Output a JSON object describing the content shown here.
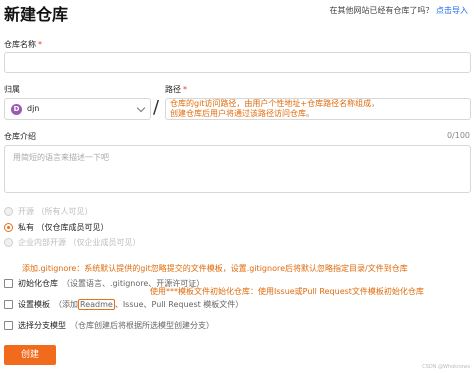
{
  "header": {
    "title": "新建仓库",
    "import_prompt": "在其他网站已经有仓库了吗？",
    "import_link": "点击导入"
  },
  "repo_name": {
    "label": "仓库名称",
    "required": "*",
    "value": ""
  },
  "owner": {
    "label": "归属",
    "avatar_letter": "D",
    "value": "djn"
  },
  "path": {
    "label": "路径",
    "required": "*",
    "separator": "/",
    "value": ""
  },
  "annotations": {
    "path_note_1": "仓库的git访问路径，由用户个性地址+仓库路径名称组成，",
    "path_note_2": "创建仓库后用户将通过该路径访问仓库。",
    "gitignore_note": "添加.gitignore：系统默认提供的git忽略提交的文件模板，设置.gitignore后将默认忽略指定目录/文件到仓库",
    "template_note": "使用***模板文件初始化仓库：使用Issue或Pull Request文件模板初始化仓库"
  },
  "description": {
    "label": "仓库介绍",
    "counter": "0/100",
    "placeholder": "用简短的语言来描述一下吧"
  },
  "visibility": [
    {
      "label": "开源 （所有人可见）",
      "checked": false,
      "disabled": true
    },
    {
      "label": "私有 （仅仓库成员可见）",
      "checked": true,
      "disabled": false
    },
    {
      "label": "企业内部开源 （仅企业成员可见）",
      "checked": false,
      "disabled": true
    }
  ],
  "options": {
    "init_repo": {
      "label": "初始化仓库",
      "hint": "（设置语言、.gitignore、开源许可证）"
    },
    "template": {
      "label": "设置模板",
      "hint_prefix": "（添加",
      "readme": "Readme",
      "hint_suffix": "、Issue、Pull Request 模板文件）"
    },
    "branch_model": {
      "label": "选择分支模型",
      "hint": "（仓库创建后将根据所选模型创建分支）"
    }
  },
  "create_button": "创建",
  "watermark": "CSDN @Whoknows",
  "colors": {
    "accent": "#f26b1d",
    "annotation": "#e06a0a",
    "required": "#e4393c",
    "link": "#1f6feb"
  }
}
